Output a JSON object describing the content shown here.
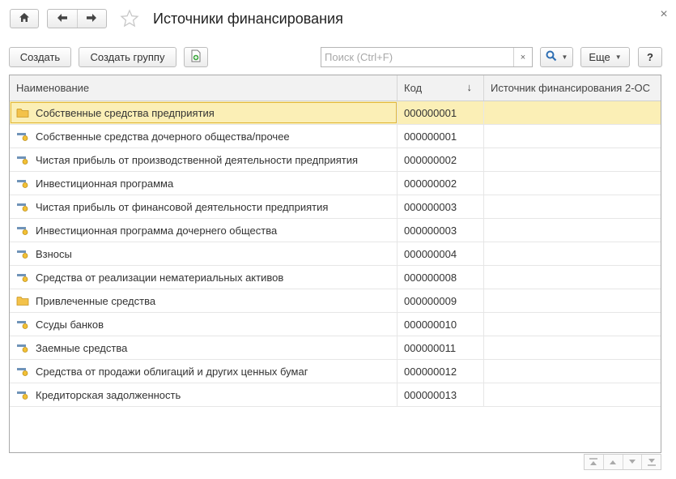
{
  "window": {
    "title": "Источники финансирования",
    "close_icon": "close-icon",
    "favorite_icon": "star-icon"
  },
  "nav": {
    "home_icon": "home-icon",
    "back_icon": "arrow-left-icon",
    "forward_icon": "arrow-right-icon"
  },
  "toolbar": {
    "create_label": "Создать",
    "create_group_label": "Создать группу",
    "copy_icon": "copy-document-icon",
    "search_placeholder": "Поиск (Ctrl+F)",
    "search_value": "",
    "search_clear": "×",
    "search_icon": "magnifier-icon",
    "more_label": "Еще",
    "help_label": "?"
  },
  "table": {
    "columns": [
      "Наименование",
      "Код",
      "Источник финансирования 2-ОС"
    ],
    "sort_indicator": "↓",
    "rows": [
      {
        "type": "folder",
        "name": "Собственные средства предприятия",
        "code": "000000001",
        "source": "",
        "selected": true
      },
      {
        "type": "item",
        "name": "Собственные средства дочерного общества/прочее",
        "code": "000000001",
        "source": ""
      },
      {
        "type": "item",
        "name": "Чистая прибыль от производственной деятельности предприятия",
        "code": "000000002",
        "source": ""
      },
      {
        "type": "item",
        "name": "Инвестиционная программа",
        "code": "000000002",
        "source": ""
      },
      {
        "type": "item",
        "name": "Чистая прибыль от финансовой деятельности предприятия",
        "code": "000000003",
        "source": ""
      },
      {
        "type": "item",
        "name": "Инвестиционная программа дочернего общества",
        "code": "000000003",
        "source": ""
      },
      {
        "type": "item",
        "name": "Взносы",
        "code": "000000004",
        "source": ""
      },
      {
        "type": "item",
        "name": "Средства от реализации нематериальных активов",
        "code": "000000008",
        "source": ""
      },
      {
        "type": "folder",
        "name": "Привлеченные средства",
        "code": "000000009",
        "source": ""
      },
      {
        "type": "item",
        "name": "Ссуды банков",
        "code": "000000010",
        "source": ""
      },
      {
        "type": "item",
        "name": "Заемные средства",
        "code": "000000011",
        "source": ""
      },
      {
        "type": "item",
        "name": "Средства от продажи облигаций и других ценных бумаг",
        "code": "000000012",
        "source": ""
      },
      {
        "type": "item",
        "name": "Кредиторская задолженность",
        "code": "000000013",
        "source": ""
      }
    ]
  },
  "scroll_controls": {
    "icons": [
      "scroll-to-top-icon",
      "scroll-up-icon",
      "scroll-down-icon",
      "scroll-to-bottom-icon"
    ]
  },
  "colors": {
    "selected_row": "#fbefb6",
    "folder_icon": "#f3c24a",
    "item_icon": "#6f93b8"
  }
}
